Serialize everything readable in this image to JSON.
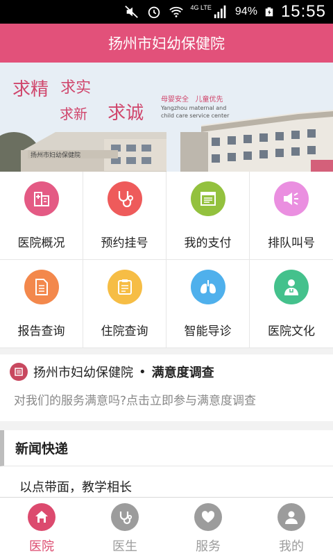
{
  "status_bar": {
    "network": "4G LTE",
    "battery": "94%",
    "time": "15:55"
  },
  "header": {
    "title": "扬州市妇幼保健院"
  },
  "banner": {
    "slogan_1": "求精",
    "slogan_2": "求实",
    "slogan_3": "求新",
    "slogan_4": "求诚",
    "motto": "母婴安全   儿童优先",
    "english_line_1": "Yangzhou maternal and",
    "english_line_2": "child care service center",
    "building_sign": "扬州市妇幼保健院"
  },
  "grid": {
    "items": [
      {
        "label": "医院概况",
        "icon": "hospital-icon",
        "color": "#e45a84"
      },
      {
        "label": "预约挂号",
        "icon": "stethoscope-icon",
        "color": "#ee5b5b"
      },
      {
        "label": "我的支付",
        "icon": "receipt-icon",
        "color": "#93c13e"
      },
      {
        "label": "排队叫号",
        "icon": "speaker-icon",
        "color": "#ea8fe0"
      },
      {
        "label": "报告查询",
        "icon": "document-icon",
        "color": "#f3884c"
      },
      {
        "label": "住院查询",
        "icon": "clipboard-icon",
        "color": "#f6bd45"
      },
      {
        "label": "智能导诊",
        "icon": "lungs-icon",
        "color": "#4fb0ec"
      },
      {
        "label": "医院文化",
        "icon": "doctor-icon",
        "color": "#44c18c"
      }
    ]
  },
  "survey": {
    "name": "扬州市妇幼保健院",
    "separator": "•",
    "title": "满意度调查",
    "prompt": "对我们的服务满意吗?点击立即参与满意度调查"
  },
  "news": {
    "heading": "新闻快递",
    "first_item": "以点带面，教学相长"
  },
  "tabs": [
    {
      "label": "医院",
      "icon": "home-icon",
      "active": true
    },
    {
      "label": "医生",
      "icon": "stethoscope-icon",
      "active": false
    },
    {
      "label": "服务",
      "icon": "heart-icon",
      "active": false
    },
    {
      "label": "我的",
      "icon": "user-icon",
      "active": false
    }
  ],
  "colors": {
    "brand": "#e2517a",
    "tab_active": "#dc4a6e",
    "tab_inactive": "#9c9c9c"
  }
}
